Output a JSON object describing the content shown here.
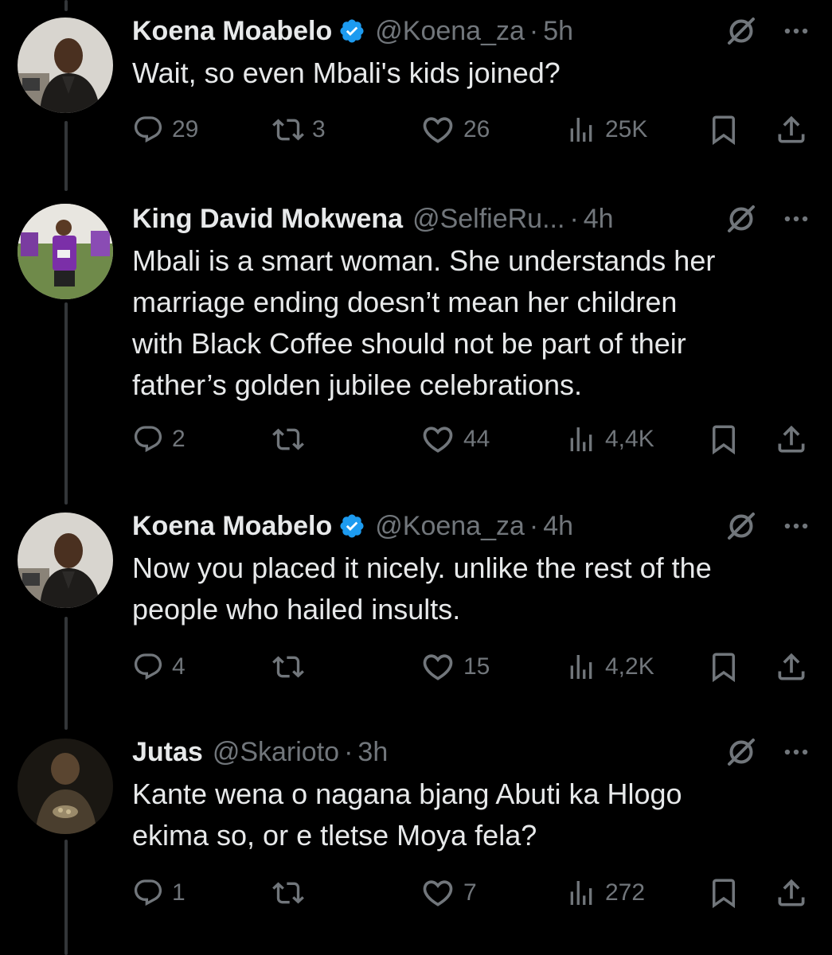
{
  "colors": {
    "background": "#000000",
    "text": "#e7e9ea",
    "muted": "#71767b",
    "verified": "#1d9bf0",
    "thread_line": "#333639"
  },
  "tweets": [
    {
      "name": "Koena Moabelo",
      "verified": true,
      "handle": "@Koena_za",
      "time": "5h",
      "text": "Wait, so even Mbali's kids joined?",
      "replies": "29",
      "reposts": "3",
      "likes": "26",
      "views": "25K"
    },
    {
      "name": "King David Mokwena",
      "verified": false,
      "handle": "@SelfieRu...",
      "time": "4h",
      "text": "Mbali is a smart woman. She understands her\nmarriage ending doesn’t mean her children\nwith Black Coffee should not be part of their\nfather’s golden jubilee celebrations.",
      "replies": "2",
      "reposts": "",
      "likes": "44",
      "views": "4,4K"
    },
    {
      "name": "Koena Moabelo",
      "verified": true,
      "handle": "@Koena_za",
      "time": "4h",
      "text": "Now you placed it nicely. unlike the rest of the\npeople who hailed insults.",
      "replies": "4",
      "reposts": "",
      "likes": "15",
      "views": "4,2K"
    },
    {
      "name": "Jutas",
      "verified": false,
      "handle": "@Skarioto",
      "time": "3h",
      "text": "Kante wena o nagana bjang Abuti ka Hlogo\nekima so, or e tletse Moya fela?",
      "replies": "1",
      "reposts": "",
      "likes": "7",
      "views": "272"
    }
  ],
  "icons": {
    "reply": "reply-icon",
    "repost": "repost-icon",
    "like": "heart-icon",
    "views": "views-icon",
    "bookmark": "bookmark-icon",
    "share": "share-icon",
    "grok": "grok-icon",
    "more": "more-icon"
  }
}
